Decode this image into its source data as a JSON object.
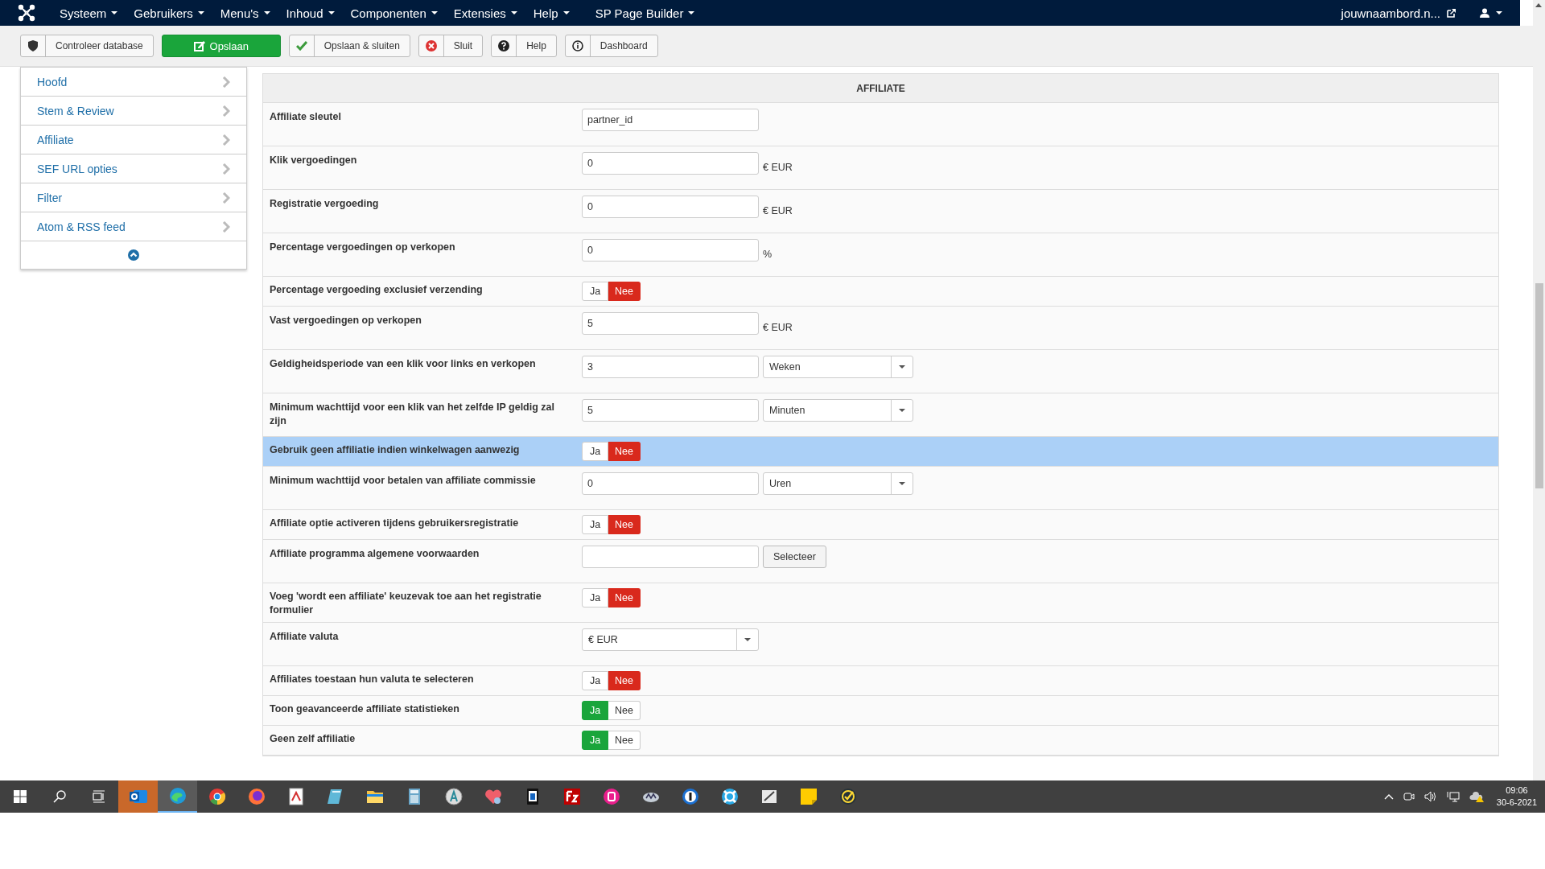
{
  "navbar": {
    "menus": [
      "Systeem",
      "Gebruikers",
      "Menu's",
      "Inhoud",
      "Componenten",
      "Extensies",
      "Help",
      "SP Page Builder"
    ],
    "site_link": "jouwnaambord.n..."
  },
  "toolbar": [
    {
      "label": "Controleer database",
      "kind": "shield",
      "primary": false
    },
    {
      "label": "Opslaan",
      "kind": "edit",
      "primary": true
    },
    {
      "label": "Opslaan & sluiten",
      "kind": "check",
      "primary": false
    },
    {
      "label": "Sluit",
      "kind": "close",
      "primary": false
    },
    {
      "label": "Help",
      "kind": "help",
      "primary": false
    },
    {
      "label": "Dashboard",
      "kind": "info",
      "primary": false
    }
  ],
  "sidebar": {
    "items": [
      "Hoofd",
      "Stem & Review",
      "Affiliate",
      "SEF URL opties",
      "Filter",
      "Atom & RSS feed"
    ]
  },
  "panel": {
    "title": "AFFILIATE",
    "rows": [
      {
        "label": "Affiliate sleutel",
        "kind": "text",
        "value": "partner_id",
        "highlighted": false
      },
      {
        "label": "Klik vergoedingen",
        "kind": "text",
        "value": "0",
        "suffix": "€ EUR",
        "highlighted": false
      },
      {
        "label": "Registratie vergoeding",
        "kind": "text",
        "value": "0",
        "suffix": "€ EUR",
        "highlighted": false
      },
      {
        "label": "Percentage vergoedingen op verkopen",
        "kind": "text",
        "value": "0",
        "suffix": "%",
        "highlighted": false
      },
      {
        "label": "Percentage vergoeding exclusief verzending",
        "kind": "toggle",
        "options": [
          {
            "label": "Ja",
            "selected": false
          },
          {
            "label": "Nee",
            "selected": true
          }
        ],
        "highlighted": false
      },
      {
        "label": "Vast vergoedingen op verkopen",
        "kind": "text",
        "value": "5",
        "suffix": "€ EUR",
        "highlighted": false
      },
      {
        "label": "Geldigheidsperiode van een klik voor links en verkopen",
        "kind": "text-select",
        "value": "3",
        "select": "Weken",
        "highlighted": false
      },
      {
        "label": "Minimum wachttijd voor een klik van het zelfde IP geldig zal zijn",
        "kind": "text-select",
        "value": "5",
        "select": "Minuten",
        "highlighted": false
      },
      {
        "label": "Gebruik geen affiliatie indien winkelwagen aanwezig",
        "kind": "toggle",
        "options": [
          {
            "label": "Ja",
            "selected": false
          },
          {
            "label": "Nee",
            "selected": true
          }
        ],
        "highlighted": true
      },
      {
        "label": "Minimum wachttijd voor betalen van affiliate commissie",
        "kind": "text-select",
        "value": "0",
        "select": "Uren",
        "highlighted": false
      },
      {
        "label": "Affiliate optie activeren tijdens gebruikersregistratie",
        "kind": "toggle",
        "options": [
          {
            "label": "Ja",
            "selected": false
          },
          {
            "label": "Nee",
            "selected": true
          }
        ],
        "highlighted": false
      },
      {
        "label": "Affiliate programma algemene voorwaarden",
        "kind": "text-button",
        "button": "Selecteer",
        "highlighted": false
      },
      {
        "label": "Voeg 'wordt een affiliate' keuzevak toe aan het registratie formulier",
        "kind": "toggle",
        "options": [
          {
            "label": "Ja",
            "selected": false
          },
          {
            "label": "Nee",
            "selected": true
          }
        ],
        "highlighted": false
      },
      {
        "label": "Affiliate valuta",
        "kind": "select",
        "select": "€ EUR",
        "highlighted": false
      },
      {
        "label": "Affiliates toestaan hun valuta te selecteren",
        "kind": "toggle",
        "options": [
          {
            "label": "Ja",
            "selected": false
          },
          {
            "label": "Nee",
            "selected": true
          }
        ],
        "highlighted": false
      },
      {
        "label": "Toon geavanceerde affiliate statistieken",
        "kind": "toggle",
        "options": [
          {
            "label": "Ja",
            "selected": true
          },
          {
            "label": "Nee",
            "selected": false
          }
        ],
        "highlighted": false
      },
      {
        "label": "Geen zelf affiliatie",
        "kind": "toggle",
        "options": [
          {
            "label": "Ja",
            "selected": true
          },
          {
            "label": "Nee",
            "selected": false
          }
        ],
        "highlighted": false
      }
    ]
  },
  "taskbar": {
    "apps": [
      {
        "kind": "outlook",
        "flashing": true,
        "active": false
      },
      {
        "kind": "edge",
        "flashing": false,
        "active": true
      },
      {
        "kind": "chrome",
        "flashing": false,
        "active": false
      },
      {
        "kind": "firefox",
        "flashing": false,
        "active": false
      },
      {
        "kind": "pdf",
        "flashing": false,
        "active": false
      },
      {
        "kind": "notepad",
        "flashing": false,
        "active": false
      },
      {
        "kind": "folder",
        "flashing": false,
        "active": false
      },
      {
        "kind": "calculator",
        "flashing": false,
        "active": false
      },
      {
        "kind": "font",
        "flashing": false,
        "active": false
      },
      {
        "kind": "heart",
        "flashing": false,
        "active": false
      },
      {
        "kind": "phone",
        "flashing": false,
        "active": false
      },
      {
        "kind": "filezilla",
        "flashing": false,
        "active": false
      },
      {
        "kind": "pink",
        "flashing": false,
        "active": false
      },
      {
        "kind": "disc",
        "flashing": false,
        "active": false
      },
      {
        "kind": "password",
        "flashing": false,
        "active": false
      },
      {
        "kind": "lifebuoy",
        "flashing": false,
        "active": false
      },
      {
        "kind": "pen",
        "flashing": false,
        "active": false
      },
      {
        "kind": "sticky",
        "flashing": false,
        "active": false
      },
      {
        "kind": "checkmark",
        "flashing": false,
        "active": false
      }
    ],
    "time": "09:06",
    "date": "30-6-2021"
  }
}
